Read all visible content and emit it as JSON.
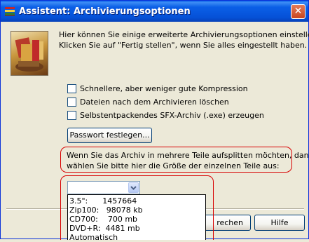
{
  "window": {
    "title": "Assistent: Archivierungsoptionen",
    "close_glyph": "✕"
  },
  "intro": {
    "line1": "Hier können Sie einige erweiterte Archivierungsoptionen einstellen.",
    "line2": "Klicken Sie auf \"Fertig stellen\", wenn Sie alles eingestellt haben."
  },
  "options": {
    "fast_compression": "Schnellere, aber weniger gute Kompression",
    "delete_after": "Dateien nach dem Archivieren löschen",
    "sfx": "Selbstentpackendes SFX-Archiv (.exe) erzeugen"
  },
  "password_button": "Passwort festlegen...",
  "split": {
    "line1": "Wenn Sie das Archiv in mehrere Teile aufsplitten möchten, dann",
    "line2": "wählen Sie bitte hier die Größe der einzelnen Teile aus:"
  },
  "split_sizes": [
    "3.5\":      1457664",
    "Zip100:   98078 kb",
    "CD700:    700 mb",
    "DVD+R:  4481 mb",
    "Automatisch"
  ],
  "footer": {
    "partial_button": "rechen",
    "help_button": "Hilfe"
  },
  "icons": {
    "title": "archive-books-icon",
    "header": "archive-wizard-illustration",
    "combo_arrow": "chevron-down-icon"
  }
}
